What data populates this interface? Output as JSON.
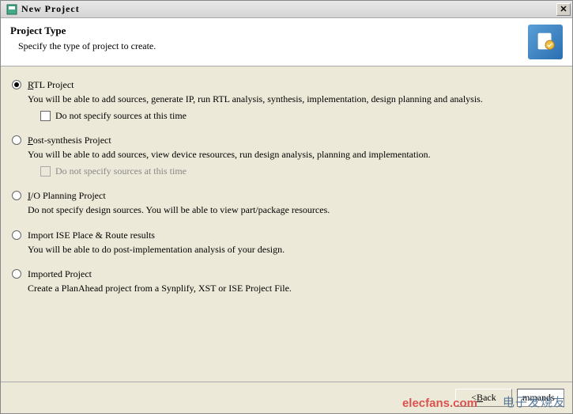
{
  "titlebar": {
    "title": "New Project",
    "close_symbol": "✕"
  },
  "header": {
    "title": "Project Type",
    "subtitle": "Specify the type of project to create."
  },
  "options": {
    "rtl": {
      "title_pre": "R",
      "title_rest": "TL Project",
      "desc": "You will be able to add sources, generate IP, run RTL analysis, synthesis, implementation, design planning and analysis.",
      "checkbox_pre": "D",
      "checkbox_rest": "o not specify sources at this time"
    },
    "postsynth": {
      "title_pre": "P",
      "title_rest": "ost-synthesis Project",
      "desc": "You will be able to add sources, view device resources, run design analysis, planning and implementation.",
      "checkbox_pre": "D",
      "checkbox_rest": "o not specify sources at this time"
    },
    "ioplanning": {
      "title_pre": "I",
      "title_rest": "/O Planning Project",
      "desc": "Do not specify design sources. You will be able to view part/package resources."
    },
    "importise": {
      "title_pre": "",
      "title_rest": "Import ISE Place & Route results",
      "desc": "You will be able to do post-implementation analysis of your design."
    },
    "imported": {
      "title_pre": "",
      "title_rest": "Imported Project",
      "desc": "Create a PlanAhead project from a Synplify, XST or ISE Project File."
    }
  },
  "footer": {
    "back_pre": "< ",
    "back_ul": "B",
    "back_rest": "ack",
    "commands": "mmands",
    "watermark1": "elecfans.com",
    "watermark2": "电子发烧友"
  }
}
